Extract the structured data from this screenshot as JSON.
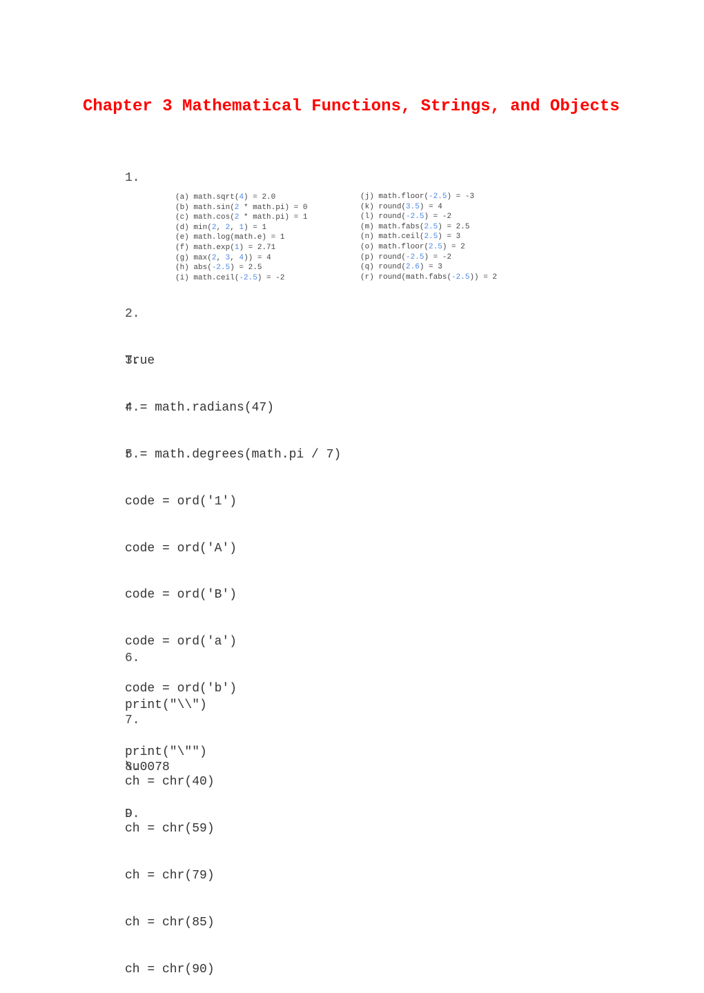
{
  "document": {
    "title": "Chapter 3 Mathematical Functions, Strings, and Objects",
    "colors": {
      "title": "#ff0000",
      "text": "#333333",
      "numeric_literal": "#4a86e8"
    }
  },
  "questions": [
    {
      "number": "1.",
      "evaluations_left": [
        {
          "label": "(a)",
          "pre": "math.sqrt(",
          "nums": [
            "4"
          ],
          "post": ") = 2.0",
          "parts": [
            [
              "math.sqrt(",
              false
            ],
            [
              "4",
              true
            ],
            [
              ") = 2.0",
              false
            ]
          ]
        },
        {
          "label": "(b)",
          "parts": [
            [
              "math.sin(",
              false
            ],
            [
              "2",
              true
            ],
            [
              " * math.pi) = 0",
              false
            ]
          ]
        },
        {
          "label": "(c)",
          "parts": [
            [
              "math.cos(",
              false
            ],
            [
              "2",
              true
            ],
            [
              " * math.pi) = 1",
              false
            ]
          ]
        },
        {
          "label": "(d)",
          "parts": [
            [
              "min(",
              false
            ],
            [
              "2",
              true
            ],
            [
              ", ",
              false
            ],
            [
              "2",
              true
            ],
            [
              ", ",
              false
            ],
            [
              "1",
              true
            ],
            [
              ") = 1",
              false
            ]
          ]
        },
        {
          "label": "(e)",
          "parts": [
            [
              "math.log(math.e) = 1",
              false
            ]
          ]
        },
        {
          "label": "(f)",
          "parts": [
            [
              "math.exp(",
              false
            ],
            [
              "1",
              true
            ],
            [
              ") = 2.71",
              false
            ]
          ]
        },
        {
          "label": "(g)",
          "parts": [
            [
              "max(",
              false
            ],
            [
              "2",
              true
            ],
            [
              ", ",
              false
            ],
            [
              "3",
              true
            ],
            [
              ", ",
              false
            ],
            [
              "4",
              true
            ],
            [
              ")) = 4",
              false
            ]
          ]
        },
        {
          "label": "(h)",
          "parts": [
            [
              "abs(",
              false
            ],
            [
              "-2.5",
              true
            ],
            [
              ") = 2.5",
              false
            ]
          ]
        },
        {
          "label": "(i)",
          "parts": [
            [
              "math.ceil(",
              false
            ],
            [
              "-2.5",
              true
            ],
            [
              ") = -2",
              false
            ]
          ]
        }
      ],
      "evaluations_right": [
        {
          "label": "(j)",
          "parts": [
            [
              "math.floor(",
              false
            ],
            [
              "-2.5",
              true
            ],
            [
              ") = -3",
              false
            ]
          ]
        },
        {
          "label": "(k)",
          "parts": [
            [
              "round(",
              false
            ],
            [
              "3.5",
              true
            ],
            [
              ") = 4",
              false
            ]
          ]
        },
        {
          "label": "(l)",
          "parts": [
            [
              "round(",
              false
            ],
            [
              "-2.5",
              true
            ],
            [
              ") = -2",
              false
            ]
          ]
        },
        {
          "label": "(m)",
          "parts": [
            [
              "math.fabs(",
              false
            ],
            [
              "2.5",
              true
            ],
            [
              ") = 2.5",
              false
            ]
          ]
        },
        {
          "label": "(n)",
          "parts": [
            [
              "math.ceil(",
              false
            ],
            [
              "2.5",
              true
            ],
            [
              ") = 3",
              false
            ]
          ]
        },
        {
          "label": "(o)",
          "parts": [
            [
              "math.floor(",
              false
            ],
            [
              "2.5",
              true
            ],
            [
              ") = 2",
              false
            ]
          ]
        },
        {
          "label": "(p)",
          "parts": [
            [
              "round(",
              false
            ],
            [
              "-2.5",
              true
            ],
            [
              ") = -2",
              false
            ]
          ]
        },
        {
          "label": "(q)",
          "parts": [
            [
              "round(",
              false
            ],
            [
              "2.6",
              true
            ],
            [
              ") = 3",
              false
            ]
          ]
        },
        {
          "label": "(r)",
          "parts": [
            [
              "round(math.fabs(",
              false
            ],
            [
              "-2.5",
              true
            ],
            [
              ")) = 2",
              false
            ]
          ]
        }
      ]
    },
    {
      "number": "2.",
      "lines": [
        "True"
      ]
    },
    {
      "number": "3.",
      "lines": [
        "r = math.radians(47)"
      ]
    },
    {
      "number": "4.",
      "lines": [
        "r = math.degrees(math.pi / 7)"
      ]
    },
    {
      "number": "5.",
      "lines": [
        "code = ord('1')",
        "code = ord('A')",
        "code = ord('B')",
        "code = ord('a')",
        "code = ord('b')",
        "",
        "ch = chr(40)",
        "ch = chr(59)",
        "ch = chr(79)",
        "ch = chr(85)",
        "ch = chr(90)"
      ]
    },
    {
      "number": "6.",
      "lines": [
        "print(\"\\\\\")",
        "print(\"\\\"\")"
      ]
    },
    {
      "number": "7.",
      "lines": [
        "\\u0078"
      ]
    },
    {
      "number": "8.",
      "lines": [
        "D"
      ]
    },
    {
      "number": "9.",
      "lines": []
    }
  ]
}
